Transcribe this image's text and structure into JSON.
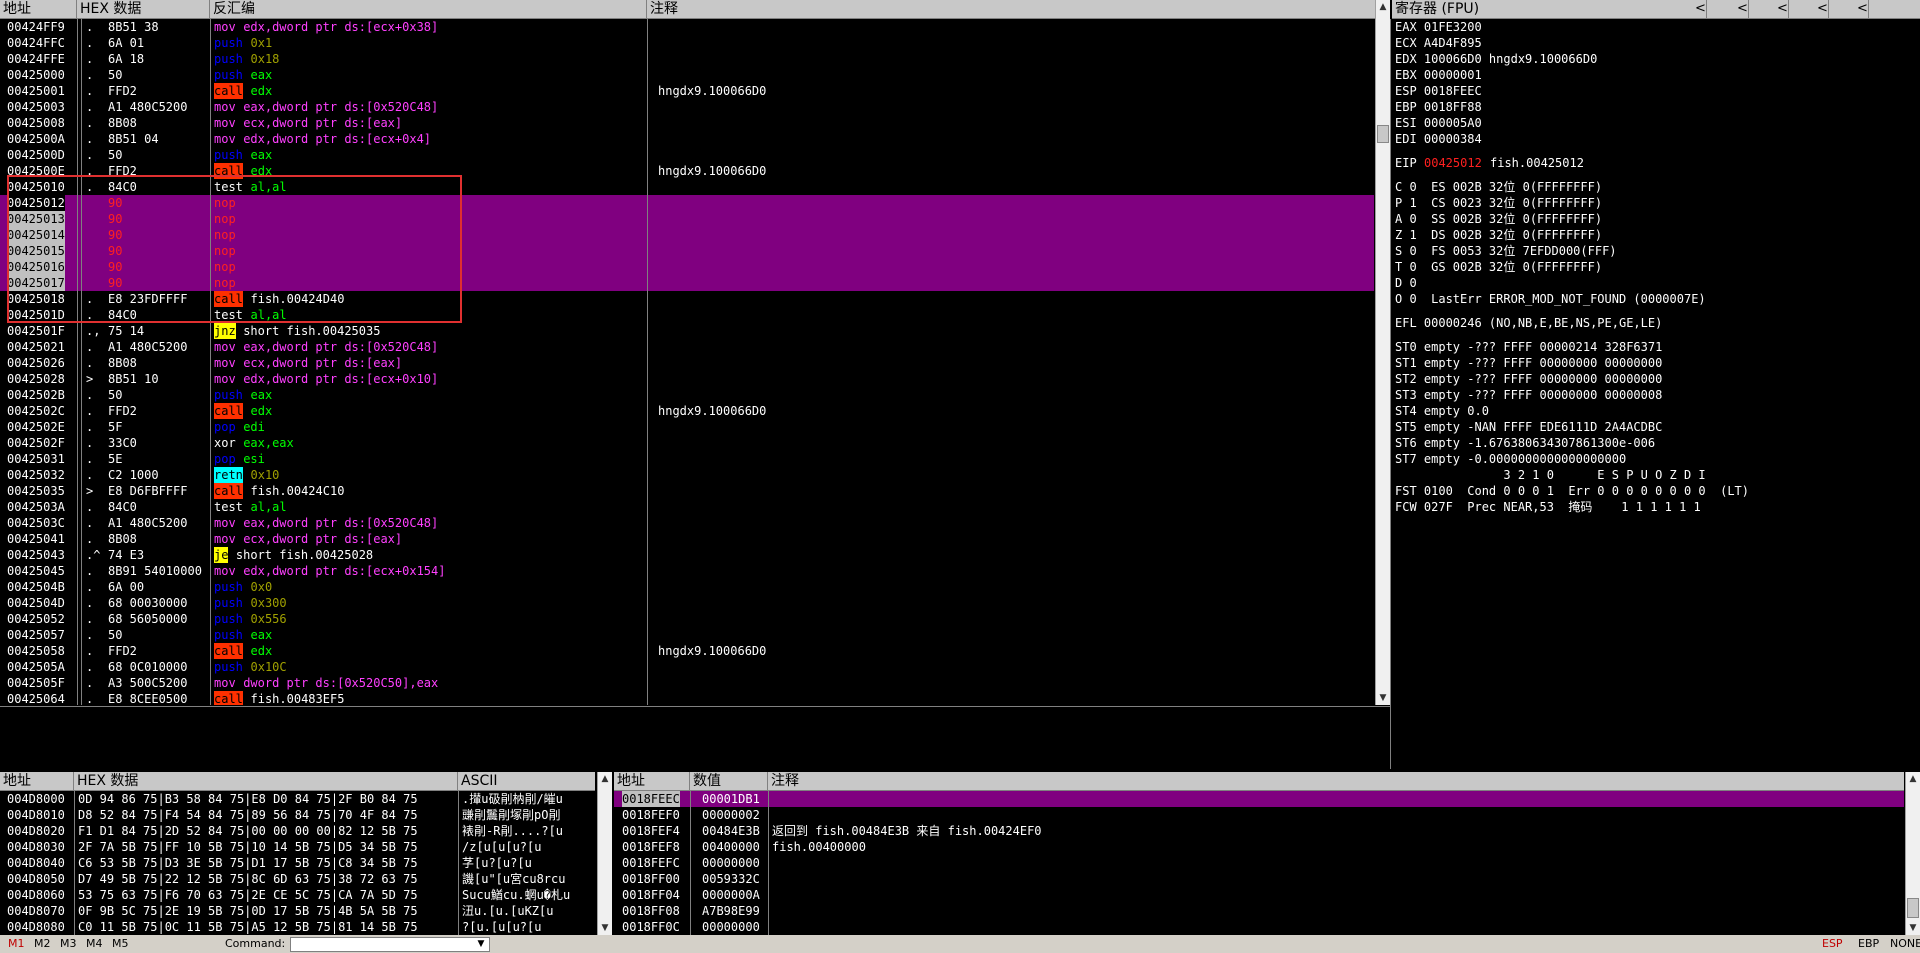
{
  "disasm": {
    "headers": {
      "addr": "地址",
      "hex": "HEX 数据",
      "asm": "反汇编",
      "comment": "注释"
    },
    "rows": [
      {
        "addr": "00424FF9",
        "m": ".",
        "hex": "8B51 38",
        "op": "mov",
        "opc": "mov",
        "args": "edx,dword ptr ds:[ecx+0x38]",
        "argc": "mov",
        "cmt": ""
      },
      {
        "addr": "00424FFC",
        "m": ".",
        "hex": "6A 01",
        "op": "push",
        "opc": "push",
        "args": "0x1",
        "argc": "arg",
        "cmt": ""
      },
      {
        "addr": "00424FFE",
        "m": ".",
        "hex": "6A 18",
        "op": "push",
        "opc": "push",
        "args": "0x18",
        "argc": "arg",
        "cmt": ""
      },
      {
        "addr": "00425000",
        "m": ".",
        "hex": "50",
        "op": "push",
        "opc": "push",
        "args": "eax",
        "argc": "reg",
        "cmt": ""
      },
      {
        "addr": "00425001",
        "m": ".",
        "hex": "FFD2",
        "op": "call",
        "opc": "call",
        "args": "edx",
        "argc": "reg",
        "cmt": "hngdx9.100066D0"
      },
      {
        "addr": "00425003",
        "m": ".",
        "hex": "A1 480C5200",
        "op": "mov",
        "opc": "mov",
        "args": "eax,dword ptr ds:[0x520C48]",
        "argc": "mov",
        "cmt": ""
      },
      {
        "addr": "00425008",
        "m": ".",
        "hex": "8B08",
        "op": "mov",
        "opc": "mov",
        "args": "ecx,dword ptr ds:[eax]",
        "argc": "mov",
        "cmt": ""
      },
      {
        "addr": "0042500A",
        "m": ".",
        "hex": "8B51 04",
        "op": "mov",
        "opc": "mov",
        "args": "edx,dword ptr ds:[ecx+0x4]",
        "argc": "mov",
        "cmt": ""
      },
      {
        "addr": "0042500D",
        "m": ".",
        "hex": "50",
        "op": "push",
        "opc": "push",
        "args": "eax",
        "argc": "reg",
        "cmt": ""
      },
      {
        "addr": "0042500E",
        "m": ".",
        "hex": "FFD2",
        "op": "call",
        "opc": "call",
        "args": "edx",
        "argc": "reg",
        "cmt": "hngdx9.100066D0"
      },
      {
        "addr": "00425010",
        "m": ".",
        "hex": "84C0",
        "op": "test",
        "opc": "white",
        "args": "al,al",
        "argc": "reg",
        "cmt": ""
      },
      {
        "addr": "00425012",
        "m": "",
        "hex": "90",
        "op": "nop",
        "opc": "nop",
        "args": "",
        "argc": "",
        "cmt": "",
        "hl": true
      },
      {
        "addr": "00425013",
        "m": "",
        "hex": "90",
        "op": "nop",
        "opc": "nop",
        "args": "",
        "argc": "",
        "cmt": "",
        "hl": true
      },
      {
        "addr": "00425014",
        "m": "",
        "hex": "90",
        "op": "nop",
        "opc": "nop",
        "args": "",
        "argc": "",
        "cmt": "",
        "hl": true
      },
      {
        "addr": "00425015",
        "m": "",
        "hex": "90",
        "op": "nop",
        "opc": "nop",
        "args": "",
        "argc": "",
        "cmt": "",
        "hl": true
      },
      {
        "addr": "00425016",
        "m": "",
        "hex": "90",
        "op": "nop",
        "opc": "nop",
        "args": "",
        "argc": "",
        "cmt": "",
        "hl": true
      },
      {
        "addr": "00425017",
        "m": "",
        "hex": "90",
        "op": "nop",
        "opc": "nop",
        "args": "",
        "argc": "",
        "cmt": "",
        "hl": true
      },
      {
        "addr": "00425018",
        "m": ".",
        "hex": "E8 23FDFFFF",
        "op": "call",
        "opc": "call",
        "args": "fish.00424D40",
        "argc": "white",
        "cmt": ""
      },
      {
        "addr": "0042501D",
        "m": ".",
        "hex": "84C0",
        "op": "test",
        "opc": "white",
        "args": "al,al",
        "argc": "reg",
        "cmt": ""
      },
      {
        "addr": "0042501F",
        "m": ".,",
        "hex": "75 14",
        "op": "jnz",
        "opc": "jcc",
        "args": "short fish.00425035",
        "argc": "white",
        "cmt": ""
      },
      {
        "addr": "00425021",
        "m": ".",
        "hex": "A1 480C5200",
        "op": "mov",
        "opc": "mov",
        "args": "eax,dword ptr ds:[0x520C48]",
        "argc": "mov",
        "cmt": ""
      },
      {
        "addr": "00425026",
        "m": ".",
        "hex": "8B08",
        "op": "mov",
        "opc": "mov",
        "args": "ecx,dword ptr ds:[eax]",
        "argc": "mov",
        "cmt": ""
      },
      {
        "addr": "00425028",
        "m": ">",
        "hex": "8B51 10",
        "op": "mov",
        "opc": "mov",
        "args": "edx,dword ptr ds:[ecx+0x10]",
        "argc": "mov",
        "cmt": ""
      },
      {
        "addr": "0042502B",
        "m": ".",
        "hex": "50",
        "op": "push",
        "opc": "push",
        "args": "eax",
        "argc": "reg",
        "cmt": ""
      },
      {
        "addr": "0042502C",
        "m": ".",
        "hex": "FFD2",
        "op": "call",
        "opc": "call",
        "args": "edx",
        "argc": "reg",
        "cmt": "hngdx9.100066D0"
      },
      {
        "addr": "0042502E",
        "m": ".",
        "hex": "5F",
        "op": "pop",
        "opc": "push",
        "args": "edi",
        "argc": "reg",
        "cmt": ""
      },
      {
        "addr": "0042502F",
        "m": ".",
        "hex": "33C0",
        "op": "xor",
        "opc": "white",
        "args": "eax,eax",
        "argc": "reg",
        "cmt": ""
      },
      {
        "addr": "00425031",
        "m": ".",
        "hex": "5E",
        "op": "pop",
        "opc": "push",
        "args": "esi",
        "argc": "reg",
        "cmt": ""
      },
      {
        "addr": "00425032",
        "m": ".",
        "hex": "C2 1000",
        "op": "retn",
        "opc": "retn",
        "args": "0x10",
        "argc": "arg",
        "cmt": ""
      },
      {
        "addr": "00425035",
        "m": ">",
        "hex": "E8 D6FBFFFF",
        "op": "call",
        "opc": "call",
        "args": "fish.00424C10",
        "argc": "white",
        "cmt": ""
      },
      {
        "addr": "0042503A",
        "m": ".",
        "hex": "84C0",
        "op": "test",
        "opc": "white",
        "args": "al,al",
        "argc": "reg",
        "cmt": ""
      },
      {
        "addr": "0042503C",
        "m": ".",
        "hex": "A1 480C5200",
        "op": "mov",
        "opc": "mov",
        "args": "eax,dword ptr ds:[0x520C48]",
        "argc": "mov",
        "cmt": ""
      },
      {
        "addr": "00425041",
        "m": ".",
        "hex": "8B08",
        "op": "mov",
        "opc": "mov",
        "args": "ecx,dword ptr ds:[eax]",
        "argc": "mov",
        "cmt": ""
      },
      {
        "addr": "00425043",
        "m": ".^",
        "hex": "74 E3",
        "op": "je",
        "opc": "jcc",
        "args": "short fish.00425028",
        "argc": "white",
        "cmt": ""
      },
      {
        "addr": "00425045",
        "m": ".",
        "hex": "8B91 54010000",
        "op": "mov",
        "opc": "mov",
        "args": "edx,dword ptr ds:[ecx+0x154]",
        "argc": "mov",
        "cmt": ""
      },
      {
        "addr": "0042504B",
        "m": ".",
        "hex": "6A 00",
        "op": "push",
        "opc": "push",
        "args": "0x0",
        "argc": "arg",
        "cmt": ""
      },
      {
        "addr": "0042504D",
        "m": ".",
        "hex": "68 00030000",
        "op": "push",
        "opc": "push",
        "args": "0x300",
        "argc": "arg",
        "cmt": ""
      },
      {
        "addr": "00425052",
        "m": ".",
        "hex": "68 56050000",
        "op": "push",
        "opc": "push",
        "args": "0x556",
        "argc": "arg",
        "cmt": ""
      },
      {
        "addr": "00425057",
        "m": ".",
        "hex": "50",
        "op": "push",
        "opc": "push",
        "args": "eax",
        "argc": "reg",
        "cmt": ""
      },
      {
        "addr": "00425058",
        "m": ".",
        "hex": "FFD2",
        "op": "call",
        "opc": "call",
        "args": "edx",
        "argc": "reg",
        "cmt": "hngdx9.100066D0"
      },
      {
        "addr": "0042505A",
        "m": ".",
        "hex": "68 0C010000",
        "op": "push",
        "opc": "push",
        "args": "0x10C",
        "argc": "arg",
        "cmt": ""
      },
      {
        "addr": "0042505F",
        "m": ".",
        "hex": "A3 500C5200",
        "op": "mov",
        "opc": "mov",
        "args": "dword ptr ds:[0x520C50],eax",
        "argc": "mov",
        "cmt": ""
      },
      {
        "addr": "00425064",
        "m": ".",
        "hex": "E8 8CEE0500",
        "op": "call",
        "opc": "call",
        "args": "fish.00483EF5",
        "argc": "white",
        "cmt": ""
      }
    ]
  },
  "registers": {
    "title": "寄存器 (FPU)",
    "nav": [
      "<",
      "<",
      "<",
      "<",
      "<"
    ],
    "gpr": [
      "EAX 01FE3200",
      "ECX A4D4F895",
      "EDX 100066D0 hngdx9.100066D0",
      "EBX 00000001",
      "ESP 0018FEEC",
      "EBP 0018FF88",
      "ESI 000005A0",
      "EDI 00000384"
    ],
    "eip_label": "EIP",
    "eip_value": "00425012",
    "eip_sym": "fish.00425012",
    "flags": [
      "C 0  ES 002B 32位 0(FFFFFFFF)",
      "P 1  CS 0023 32位 0(FFFFFFFF)",
      "A 0  SS 002B 32位 0(FFFFFFFF)",
      "Z 1  DS 002B 32位 0(FFFFFFFF)",
      "S 0  FS 0053 32位 7EFDD000(FFF)",
      "T 0  GS 002B 32位 0(FFFFFFFF)",
      "D 0",
      "O 0  LastErr ERROR_MOD_NOT_FOUND (0000007E)"
    ],
    "efl": "EFL 00000246 (NO,NB,E,BE,NS,PE,GE,LE)",
    "fpu": [
      "ST0 empty -??? FFFF 00000214 328F6371",
      "ST1 empty -??? FFFF 00000000 00000000",
      "ST2 empty -??? FFFF 00000000 00000000",
      "ST3 empty -??? FFFF 00000000 00000008",
      "ST4 empty 0.0",
      "ST5 empty -NAN FFFF EDE6111D 2A4ACDBC",
      "ST6 empty -1.676380634307861300e-006",
      "ST7 empty -0.0000000000000000000"
    ],
    "fst_hdr": "               3 2 1 0      E S P U O Z D I",
    "fst": "FST 0100  Cond 0 0 0 1  Err 0 0 0 0 0 0 0 0  (LT)",
    "fcw": "FCW 027F  Prec NEAR,53  掩码    1 1 1 1 1 1"
  },
  "dump": {
    "headers": {
      "addr": "地址",
      "hex": "HEX 数据",
      "ascii": "ASCII"
    },
    "rows": [
      {
        "addr": "004D8000",
        "hex": "0D 94 86 75|B3 58 84 75|E8 D0 84 75|2F B0 84 75",
        "ascii": ".攆u砐剈枘剈/皠u"
      },
      {
        "addr": "004D8010",
        "hex": "D8 52 84 75|F4 54 84 75|89 56 84 75|70 4F 84 75",
        "ascii": "豏剈鬞剈塚剈pO剈"
      },
      {
        "addr": "004D8020",
        "hex": "F1 D1 84 75|2D 52 84 75|00 00 00 00|82 12 5B 75",
        "ascii": "裱剈-R剈....?[u"
      },
      {
        "addr": "004D8030",
        "hex": "2F 7A 5B 75|FF 10 5B 75|10 14 5B 75|D5 34 5B 75",
        "ascii": "/z[u[u[u?[u"
      },
      {
        "addr": "004D8040",
        "hex": "C6 53 5B 75|D3 3E 5B 75|D1 17 5B 75|C8 34 5B 75",
        "ascii": "芓[u?[u?[u"
      },
      {
        "addr": "004D8050",
        "hex": "D7 49 5B 75|22 12 5B 75|8C 6D 63 75|38 72 63 75",
        "ascii": "譏[u\"[u宮cu8rcu"
      },
      {
        "addr": "004D8060",
        "hex": "53 75 63 75|F6 70 63 75|2E CE 5C 75|CA 7A 5D 75",
        "ascii": "Sucu鰌cu.蝄u�札u"
      },
      {
        "addr": "004D8070",
        "hex": "0F 9B 5C 75|2E 19 5B 75|0D 17 5B 75|4B 5A 5B 75",
        "ascii": "沑u.[u.[uKZ[u"
      },
      {
        "addr": "004D8080",
        "hex": "C0 11 5B 75|0C 11 5B 75|A5 12 5B 75|81 14 5B 75",
        "ascii": "?[u.[u[u?[u"
      }
    ]
  },
  "stack": {
    "headers": {
      "addr": "地址",
      "val": "数值",
      "cmt": "注释"
    },
    "rows": [
      {
        "addr": "0018FEEC",
        "val": "00001DB1",
        "cmt": "",
        "hl": true
      },
      {
        "addr": "0018FEF0",
        "val": "00000002",
        "cmt": ""
      },
      {
        "addr": "0018FEF4",
        "val": "00484E3B",
        "cmt": "返回到 fish.00484E3B 来自 fish.00424EF0"
      },
      {
        "addr": "0018FEF8",
        "val": "00400000",
        "cmt": "fish.00400000"
      },
      {
        "addr": "0018FEFC",
        "val": "00000000",
        "cmt": ""
      },
      {
        "addr": "0018FF00",
        "val": "0059332C",
        "cmt": ""
      },
      {
        "addr": "0018FF04",
        "val": "0000000A",
        "cmt": ""
      },
      {
        "addr": "0018FF08",
        "val": "A7B98E99",
        "cmt": ""
      },
      {
        "addr": "0018FF0C",
        "val": "00000000",
        "cmt": ""
      }
    ]
  },
  "statusbar": {
    "tabs": [
      "M1",
      "M2",
      "M3",
      "M4",
      "M5"
    ],
    "command_label": "Command:",
    "right": [
      "ESP",
      "EBP",
      "NONE"
    ]
  },
  "colors": {
    "highlight": "#800080",
    "red_box": "#e03030",
    "active_tab": "#c00000"
  }
}
